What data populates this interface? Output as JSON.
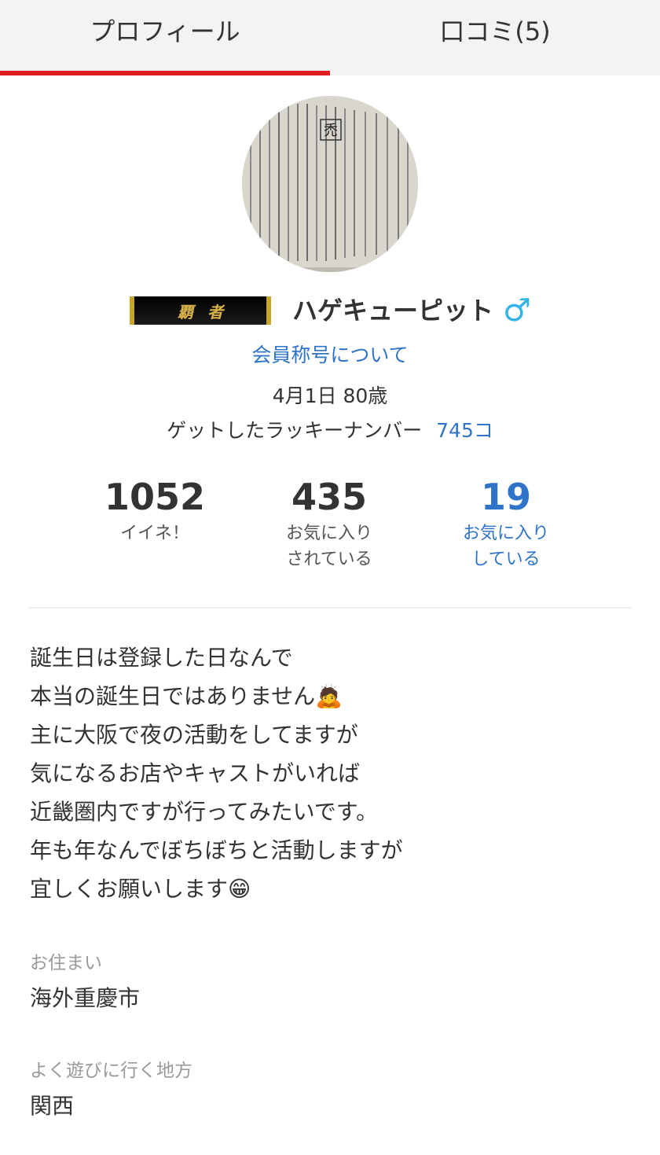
{
  "tabs": {
    "profile": "プロフィール",
    "reviews": "口コミ(5)"
  },
  "profile": {
    "title_badge": "覇者",
    "name": "ハゲキューピット",
    "gender_symbol": "♂",
    "rank_link": "会員称号について",
    "birth_age": "4月1日 80歳",
    "lucky_label": "ゲットしたラッキーナンバー",
    "lucky_count": "745コ"
  },
  "stats": {
    "likes": {
      "number": "1052",
      "label": "イイネ！"
    },
    "faved_by": {
      "number": "435",
      "label": "お気に入り\nされている"
    },
    "faving": {
      "number": "19",
      "label": "お気に入り\nしている"
    }
  },
  "bio": {
    "lines": [
      "誕生日は登録した日なんで",
      "本当の誕生日ではありません🙇",
      "主に大阪で夜の活動をしてますが",
      "気になるお店やキャストがいれば",
      "近畿圏内ですが行ってみたいです。",
      "年も年なんでぼちぼちと活動しますが",
      "宜しくお願いします😁"
    ]
  },
  "details": {
    "residence_label": "お住まい",
    "residence_value": "海外重慶市",
    "area_label": "よく遊びに行く地方",
    "area_value": "関西"
  },
  "colors": {
    "accent_red": "#e01e22",
    "link_blue": "#2f74c8",
    "gender_blue": "#34b4e6"
  },
  "avatar": {
    "image_text": {
      "headword": "禿",
      "body": "秃は俗字 禿トク はげ 頭に毛がない 草木がない 山に木がない 私物 私法 私有 私製 私費 公私 私見 私利"
    }
  }
}
